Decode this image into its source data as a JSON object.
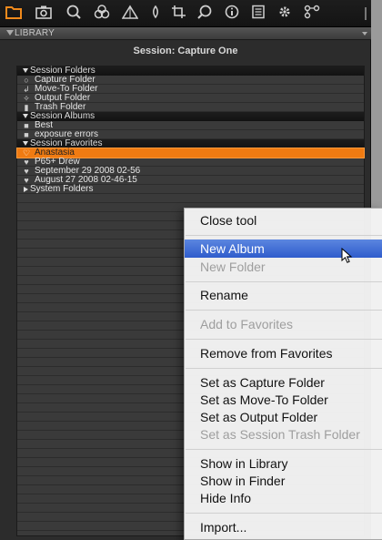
{
  "toolbar": {
    "icons": [
      "folder-icon",
      "camera-icon",
      "search-icon",
      "color-icon",
      "exposure-icon",
      "focus-icon",
      "crop-icon",
      "lens-icon",
      "info-icon",
      "metadata-icon",
      "settings-icon",
      "network-icon"
    ]
  },
  "library": {
    "header": "LIBRARY",
    "session_title": "Session: Capture One"
  },
  "groups": {
    "session_folders": "Session Folders",
    "session_albums": "Session Albums",
    "session_favorites": "Session Favorites",
    "system_folders": "System Folders"
  },
  "items": {
    "capture_folder": "Capture Folder",
    "move_to_folder": "Move-To Folder",
    "output_folder": "Output Folder",
    "trash_folder": "Trash Folder",
    "best": "Best",
    "exposure_errors": "exposure errors",
    "anastasia": "Anastasia",
    "p65_drew": "P65+ Drew",
    "september": "September 29 2008 02-56",
    "august": "August 27 2008 02-46-15"
  },
  "context_menu": {
    "close_tool": "Close tool",
    "new_album": "New Album",
    "new_folder": "New Folder",
    "rename": "Rename",
    "add_to_favorites": "Add to Favorites",
    "remove_from_favorites": "Remove from Favorites",
    "set_capture": "Set as Capture Folder",
    "set_move_to": "Set as Move-To Folder",
    "set_output": "Set as Output Folder",
    "set_trash": "Set as Session Trash Folder",
    "show_in_library": "Show in Library",
    "show_in_finder": "Show in Finder",
    "hide_info": "Hide Info",
    "import": "Import..."
  },
  "colors": {
    "accent": "#f07b12",
    "menu_highlight": "#3f6fd6",
    "panel_bg": "#2c2c2c"
  }
}
